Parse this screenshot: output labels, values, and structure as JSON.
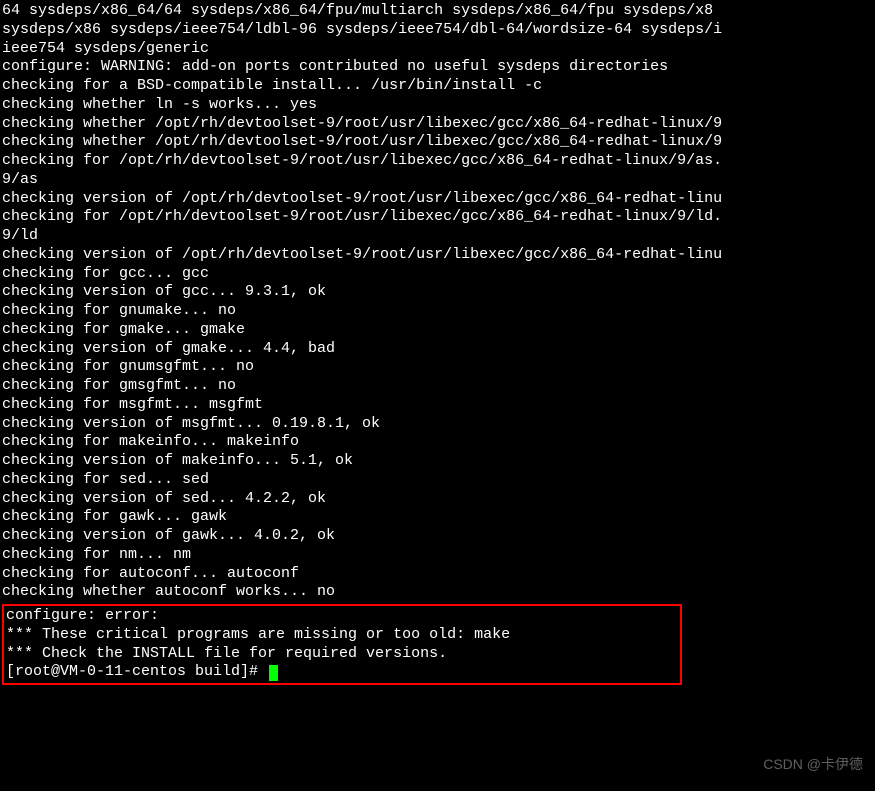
{
  "terminal": {
    "lines": [
      "64 sysdeps/x86_64/64 sysdeps/x86_64/fpu/multiarch sysdeps/x86_64/fpu sysdeps/x8",
      "sysdeps/x86 sysdeps/ieee754/ldbl-96 sysdeps/ieee754/dbl-64/wordsize-64 sysdeps/i",
      "ieee754 sysdeps/generic",
      "configure: WARNING: add-on ports contributed no useful sysdeps directories",
      "checking for a BSD-compatible install... /usr/bin/install -c",
      "checking whether ln -s works... yes",
      "checking whether /opt/rh/devtoolset-9/root/usr/libexec/gcc/x86_64-redhat-linux/9",
      "checking whether /opt/rh/devtoolset-9/root/usr/libexec/gcc/x86_64-redhat-linux/9",
      "checking for /opt/rh/devtoolset-9/root/usr/libexec/gcc/x86_64-redhat-linux/9/as.",
      "9/as",
      "checking version of /opt/rh/devtoolset-9/root/usr/libexec/gcc/x86_64-redhat-linu",
      "checking for /opt/rh/devtoolset-9/root/usr/libexec/gcc/x86_64-redhat-linux/9/ld.",
      "9/ld",
      "checking version of /opt/rh/devtoolset-9/root/usr/libexec/gcc/x86_64-redhat-linu",
      "checking for gcc... gcc",
      "checking version of gcc... 9.3.1, ok",
      "checking for gnumake... no",
      "checking for gmake... gmake",
      "checking version of gmake... 4.4, bad",
      "checking for gnumsgfmt... no",
      "checking for gmsgfmt... no",
      "checking for msgfmt... msgfmt",
      "checking version of msgfmt... 0.19.8.1, ok",
      "checking for makeinfo... makeinfo",
      "checking version of makeinfo... 5.1, ok",
      "checking for sed... sed",
      "checking version of sed... 4.2.2, ok",
      "checking for gawk... gawk",
      "checking version of gawk... 4.0.2, ok",
      "checking for nm... nm",
      "checking for autoconf... autoconf",
      "checking whether autoconf works... no"
    ],
    "error_lines": [
      "configure: error:",
      "*** These critical programs are missing or too old: make",
      "*** Check the INSTALL file for required versions."
    ],
    "prompt": "[root@VM-0-11-centos build]# "
  },
  "watermark": "CSDN @卡伊德"
}
